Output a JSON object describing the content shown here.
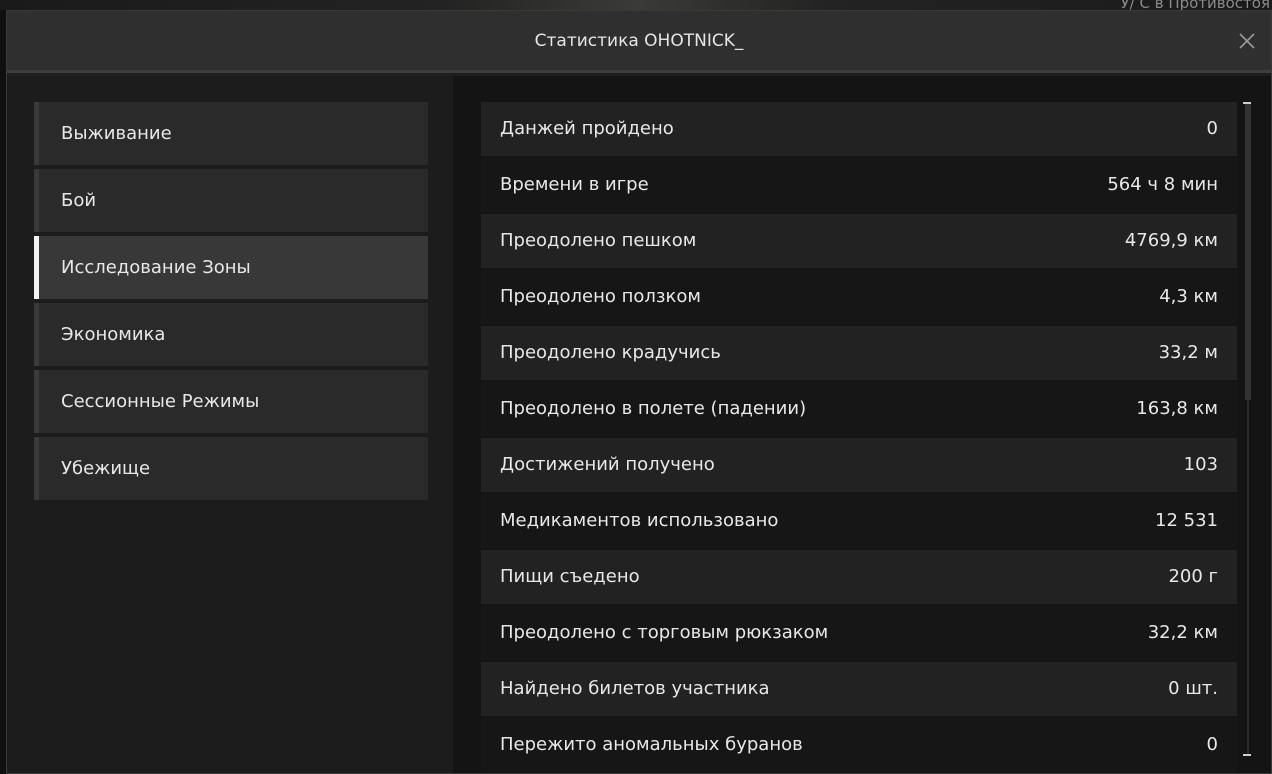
{
  "background": {
    "text": "У/ С в Противостоя"
  },
  "window": {
    "title": "Статистика OHOTNICK_",
    "close_icon": "close-icon"
  },
  "categories": [
    {
      "label": "Выживание",
      "active": false
    },
    {
      "label": "Бой",
      "active": false
    },
    {
      "label": "Исследование Зоны",
      "active": true
    },
    {
      "label": "Экономика",
      "active": false
    },
    {
      "label": "Сессионные Режимы",
      "active": false
    },
    {
      "label": "Убежище",
      "active": false
    }
  ],
  "stats": [
    {
      "label": "Данжей пройдено",
      "value": "0"
    },
    {
      "label": "Времени в игре",
      "value": "564 ч 8 мин"
    },
    {
      "label": "Преодолено пешком",
      "value": "4769,9 км"
    },
    {
      "label": "Преодолено ползком",
      "value": "4,3 км"
    },
    {
      "label": "Преодолено крадучись",
      "value": "33,2 м"
    },
    {
      "label": "Преодолено в полете (падении)",
      "value": "163,8 км"
    },
    {
      "label": "Достижений получено",
      "value": "103"
    },
    {
      "label": "Медикаментов использовано",
      "value": "12 531"
    },
    {
      "label": "Пищи съедено",
      "value": "200 г"
    },
    {
      "label": "Преодолено с торговым рюкзаком",
      "value": "32,2 км"
    },
    {
      "label": "Найдено билетов участника",
      "value": "0 шт."
    },
    {
      "label": "Пережито аномальных буранов",
      "value": "0"
    }
  ],
  "colors": {
    "accent": "#f2f2f2",
    "text": "#e8e8e8",
    "active_bg": "#383838"
  }
}
